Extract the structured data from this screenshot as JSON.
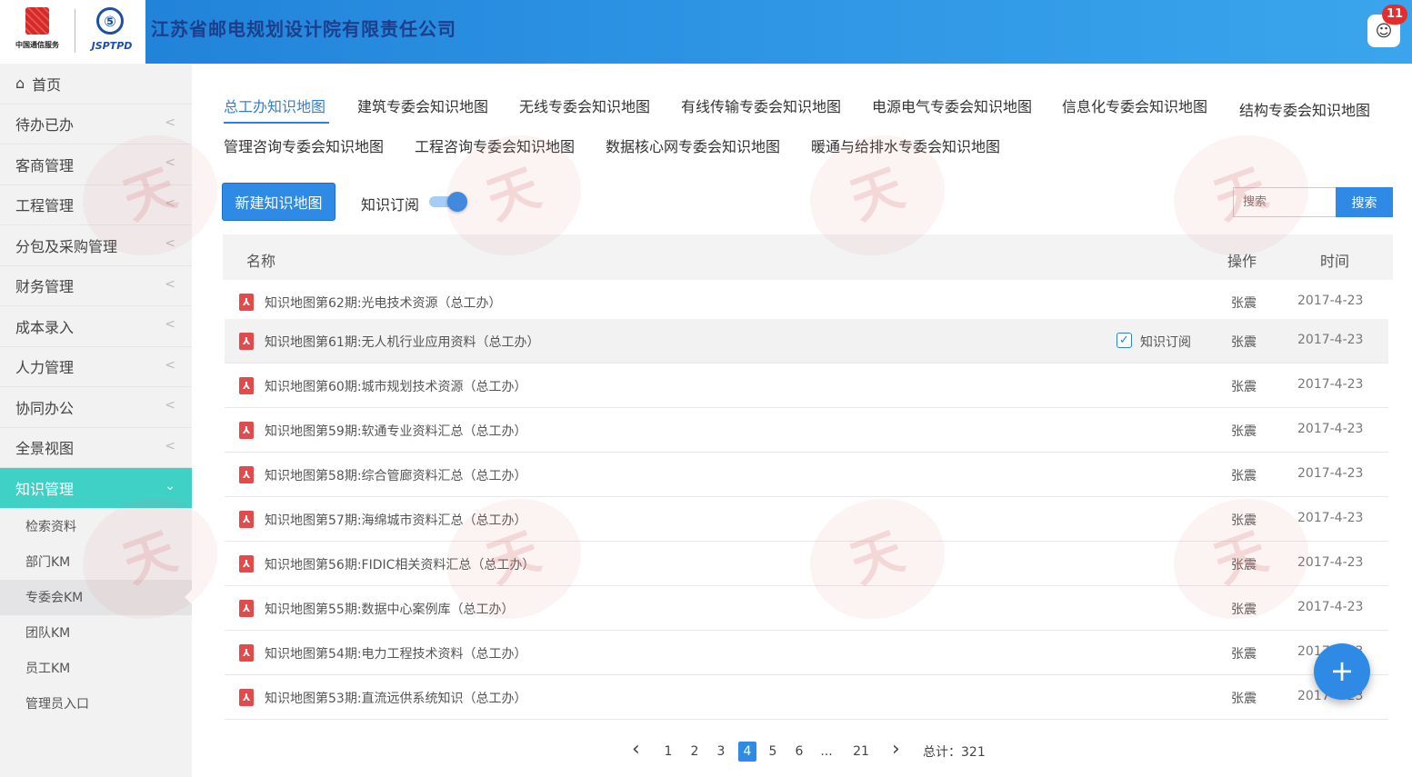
{
  "header": {
    "logo_left_text": "中国通信服务",
    "logo_right_text": "JSPTPD",
    "company_name": "江苏省邮电规划设计院有限责任公司",
    "notification_count": "11"
  },
  "sidebar": {
    "items": [
      {
        "label": "首页"
      },
      {
        "label": "待办已办"
      },
      {
        "label": "客商管理"
      },
      {
        "label": "工程管理"
      },
      {
        "label": "分包及采购管理"
      },
      {
        "label": "财务管理"
      },
      {
        "label": "成本录入"
      },
      {
        "label": "人力管理"
      },
      {
        "label": "协同办公"
      },
      {
        "label": "全景视图"
      },
      {
        "label": "知识管理"
      }
    ],
    "sub_items": [
      {
        "label": "检索资料"
      },
      {
        "label": "部门KM"
      },
      {
        "label": "专委会KM"
      },
      {
        "label": "团队KM"
      },
      {
        "label": "员工KM"
      },
      {
        "label": "管理员入口"
      }
    ]
  },
  "tabs": [
    {
      "label": "总工办知识地图"
    },
    {
      "label": "建筑专委会知识地图"
    },
    {
      "label": "无线专委会知识地图"
    },
    {
      "label": "有线传输专委会知识地图"
    },
    {
      "label": "电源电气专委会知识地图"
    },
    {
      "label": "信息化专委会知识地图"
    },
    {
      "label": "结构专委会知识地图"
    },
    {
      "label": "管理咨询专委会知识地图"
    },
    {
      "label": "工程咨询专委会知识地图"
    },
    {
      "label": "数据核心网专委会知识地图"
    },
    {
      "label": "暖通与给排水专委会知识地图"
    }
  ],
  "toolbar": {
    "new_button": "新建知识地图",
    "subscribe_label": "知识订阅",
    "search_placeholder": "搜索",
    "search_button": "搜索"
  },
  "table": {
    "col_name": "名称",
    "col_op": "操作",
    "col_time": "时间",
    "subscribe_text": "知识订阅",
    "rows": [
      {
        "title": "知识地图第62期:光电技术资源（总工办）",
        "op": "张震",
        "time": "2017-4-23"
      },
      {
        "title": "知识地图第61期:无人机行业应用资料（总工办）",
        "op": "张震",
        "time": "2017-4-23"
      },
      {
        "title": "知识地图第60期:城市规划技术资源（总工办）",
        "op": "张震",
        "time": "2017-4-23"
      },
      {
        "title": "知识地图第59期:软通专业资料汇总（总工办）",
        "op": "张震",
        "time": "2017-4-23"
      },
      {
        "title": "知识地图第58期:综合管廊资料汇总（总工办）",
        "op": "张震",
        "time": "2017-4-23"
      },
      {
        "title": "知识地图第57期:海绵城市资料汇总（总工办）",
        "op": "张震",
        "time": "2017-4-23"
      },
      {
        "title": "知识地图第56期:FIDIC相关资料汇总（总工办）",
        "op": "张震",
        "time": "2017-4-23"
      },
      {
        "title": "知识地图第55期:数据中心案例库（总工办）",
        "op": "张震",
        "time": "2017-4-23"
      },
      {
        "title": "知识地图第54期:电力工程技术资料（总工办）",
        "op": "张震",
        "time": "2017-4-23"
      },
      {
        "title": "知识地图第53期:直流远供系统知识（总工办）",
        "op": "张震",
        "time": "2017-4-23"
      }
    ]
  },
  "pagination": {
    "pages": [
      "1",
      "2",
      "3",
      "4",
      "5",
      "6",
      "...",
      "21"
    ],
    "current": "4",
    "total": "总计：321"
  },
  "fab_label": "+",
  "colors": {
    "accent": "#2f8ae6",
    "active_nav": "#3fd1c6",
    "header": "#2d94e4"
  }
}
